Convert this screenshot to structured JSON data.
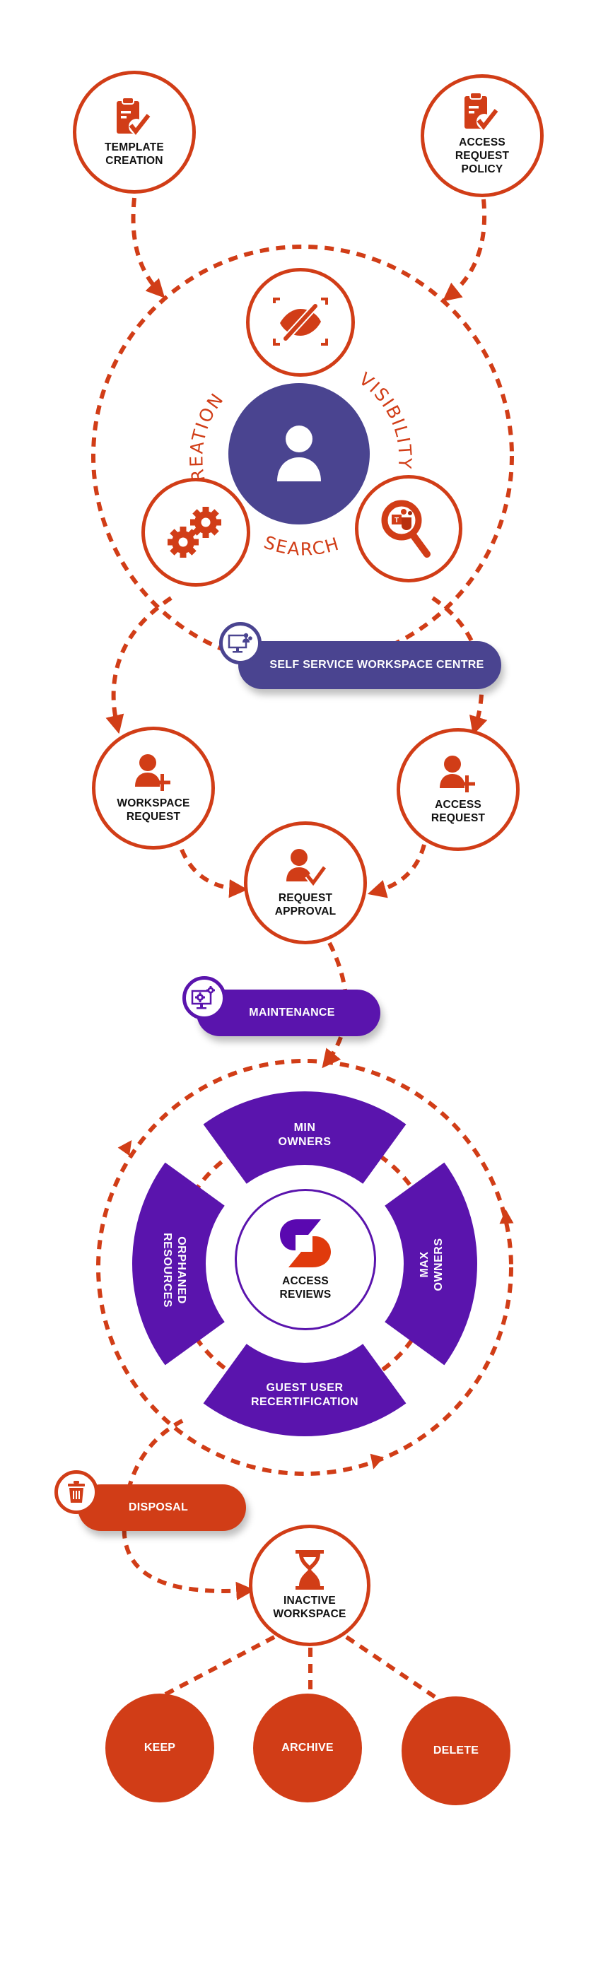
{
  "colors": {
    "accent_orange": "#d13d17",
    "hub_purple": "#4a4490",
    "maintenance_purple": "#5a14ad",
    "label_text": "#111111",
    "logo_purple": "#5a08b0",
    "logo_orange": "#e03a0c"
  },
  "inputs": {
    "template_creation": {
      "icon": "clipboard-check-icon",
      "lines": [
        "TEMPLATE",
        "CREATION"
      ]
    },
    "access_request_policy": {
      "icon": "clipboard-check-icon",
      "lines": [
        "ACCESS",
        "REQUEST",
        "POLICY"
      ]
    }
  },
  "hub": {
    "center_icon": "user-icon",
    "words": {
      "creation": "CREATION",
      "visibility": "VISIBILITY",
      "search": "SEARCH"
    },
    "satellites": [
      {
        "name": "visibility",
        "icon": "eye-slash-icon"
      },
      {
        "name": "creation",
        "icon": "gears-icon"
      },
      {
        "name": "search",
        "icon": "teams-search-icon"
      }
    ]
  },
  "self_service": {
    "label": "SELF SERVICE WORKSPACE CENTRE",
    "icon": "monitor-users-icon"
  },
  "requests": {
    "workspace_request": {
      "icon": "user-plus-icon",
      "lines": [
        "WORKSPACE",
        "REQUEST"
      ]
    },
    "access_request": {
      "icon": "user-plus-icon",
      "lines": [
        "ACCESS",
        "REQUEST"
      ]
    },
    "request_approval": {
      "icon": "user-check-icon",
      "lines": [
        "REQUEST",
        "APPROVAL"
      ]
    }
  },
  "maintenance": {
    "label": "MAINTENANCE",
    "icon": "monitor-gears-icon"
  },
  "access_reviews": {
    "center_lines": [
      "ACCESS",
      "REVIEWS"
    ],
    "logo": "brand-s-logo",
    "segments": {
      "top": [
        "MIN",
        "OWNERS"
      ],
      "right": [
        "MAX",
        "OWNERS"
      ],
      "bottom": [
        "GUEST USER",
        "RECERTIFICATION"
      ],
      "left": [
        "ORPHANED",
        "RESOURCES"
      ]
    }
  },
  "disposal": {
    "label": "DISPOSAL",
    "icon": "trash-icon"
  },
  "inactive_workspace": {
    "icon": "hourglass-icon",
    "lines": [
      "INACTIVE",
      "WORKSPACE"
    ]
  },
  "outcomes": [
    "KEEP",
    "ARCHIVE",
    "DELETE"
  ]
}
